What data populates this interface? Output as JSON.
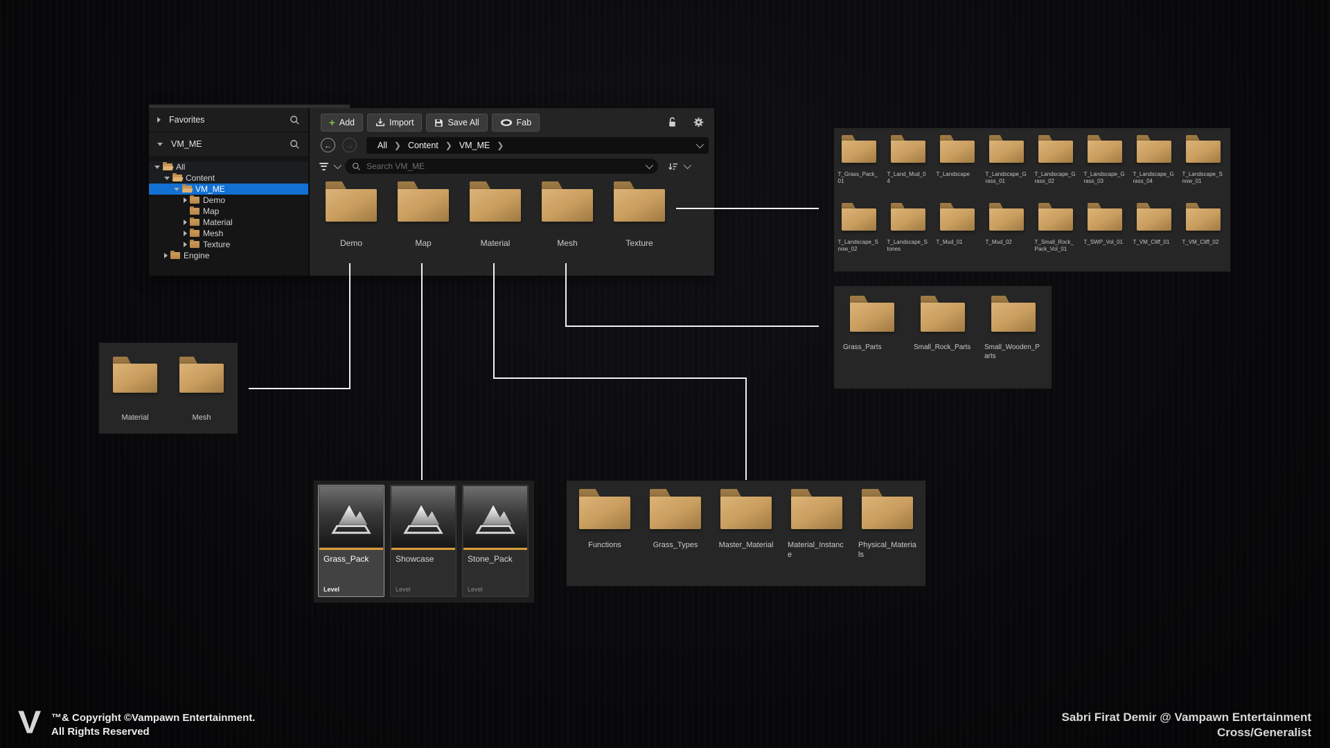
{
  "window": {
    "favorites_label": "Favorites",
    "collection_label": "VM_ME",
    "toolbar": {
      "add": "Add",
      "import": "Import",
      "save_all": "Save All",
      "fab": "Fab"
    },
    "breadcrumb": {
      "items": [
        "All",
        "Content",
        "VM_ME"
      ]
    },
    "search": {
      "placeholder": "Search VM_ME"
    },
    "tree": [
      {
        "label": "All",
        "depth": 0,
        "expander": "open",
        "icon": "open",
        "selected": false
      },
      {
        "label": "Content",
        "depth": 1,
        "expander": "open",
        "icon": "open",
        "selected": false
      },
      {
        "label": "VM_ME",
        "depth": 2,
        "expander": "open",
        "icon": "open",
        "selected": true
      },
      {
        "label": "Demo",
        "depth": 3,
        "expander": "closed",
        "icon": "closed",
        "selected": false
      },
      {
        "label": "Map",
        "depth": 3,
        "expander": "none",
        "icon": "closed",
        "selected": false
      },
      {
        "label": "Material",
        "depth": 3,
        "expander": "closed",
        "icon": "closed",
        "selected": false
      },
      {
        "label": "Mesh",
        "depth": 3,
        "expander": "closed",
        "icon": "closed",
        "selected": false
      },
      {
        "label": "Texture",
        "depth": 3,
        "expander": "closed",
        "icon": "closed",
        "selected": false
      },
      {
        "label": "Engine",
        "depth": 1,
        "expander": "closed",
        "icon": "closed",
        "selected": false
      }
    ],
    "folders": [
      "Demo",
      "Map",
      "Material",
      "Mesh",
      "Texture"
    ]
  },
  "panels": {
    "texture": {
      "items": [
        "T_Grass_Pack_01",
        "T_Land_Mud_04",
        "T_Landscape",
        "T_Landscape_Grass_01",
        "T_Landscape_Grass_02",
        "T_Landscape_Grass_03",
        "T_Landscape_Grass_04",
        "T_Landscape_Snow_01",
        "T_Landscape_Snow_02",
        "T_Landscape_Stones",
        "T_Mud_01",
        "T_Mud_02",
        "T_Small_Rock_Pack_Vol_01",
        "T_SWP_Vol_01",
        "T_VM_Cliff_01",
        "T_VM_Cliff_02"
      ]
    },
    "mesh": {
      "items": [
        "Grass_Parts",
        "Small_Rock_Parts",
        "Small_Wooden_Parts"
      ]
    },
    "demo": {
      "items": [
        "Material",
        "Mesh"
      ]
    },
    "map": {
      "items": [
        {
          "name": "Grass_Pack",
          "type": "Level",
          "selected": true
        },
        {
          "name": "Showcase",
          "type": "Level",
          "selected": false
        },
        {
          "name": "Stone_Pack",
          "type": "Level",
          "selected": false
        }
      ]
    },
    "material": {
      "items": [
        "Functions",
        "Grass_Types",
        "Master_Material",
        "Material_Instance",
        "Physical_Materials"
      ]
    }
  },
  "footer": {
    "logo": "V",
    "copyright_line1": "™& Copyright ©Vampawn Entertainment.",
    "copyright_line2": "All Rights Reserved",
    "credit_line1": "Sabri Firat Demir @ Vampawn Entertainment",
    "credit_line2": "Cross/Generalist"
  },
  "colors": {
    "selection_blue": "#1371d3",
    "folder_tan": "#c99e5f",
    "level_orange": "#d99a36",
    "connector_white": "#f2f2f2",
    "add_green": "#7cc24b"
  }
}
